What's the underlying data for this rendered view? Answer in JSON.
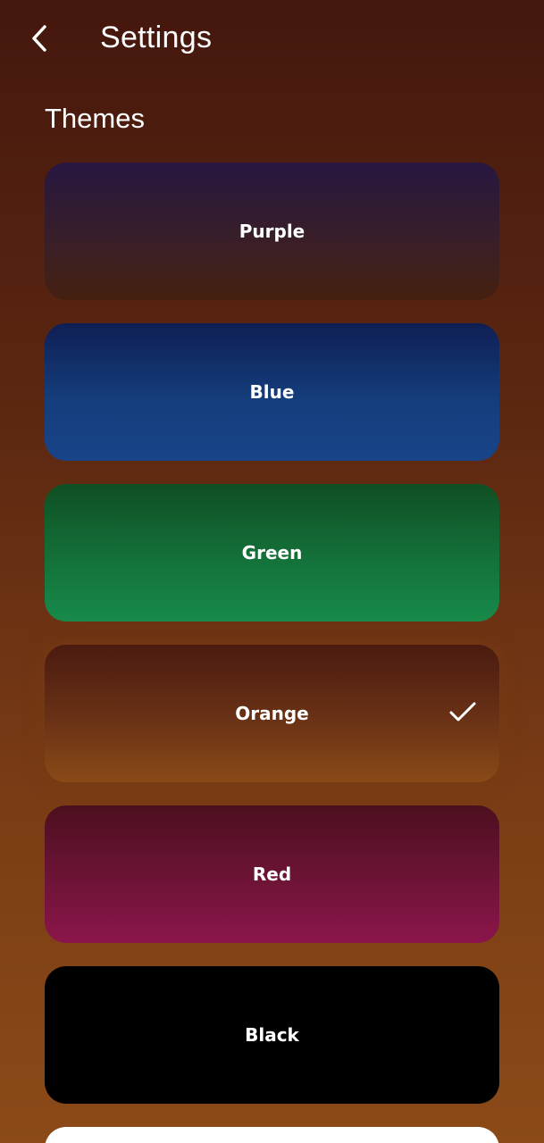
{
  "header": {
    "back_icon": "chevron-left-icon",
    "title": "Settings"
  },
  "section": {
    "title": "Themes"
  },
  "themes": [
    {
      "label": "Purple",
      "selected": false
    },
    {
      "label": "Blue",
      "selected": false
    },
    {
      "label": "Green",
      "selected": false
    },
    {
      "label": "Orange",
      "selected": true
    },
    {
      "label": "Red",
      "selected": false
    },
    {
      "label": "Black",
      "selected": false
    },
    {
      "label": "",
      "selected": false
    }
  ],
  "colors": {
    "text": "#ffffff",
    "background_top": "#45170d",
    "background_bottom": "#8b4a17"
  }
}
